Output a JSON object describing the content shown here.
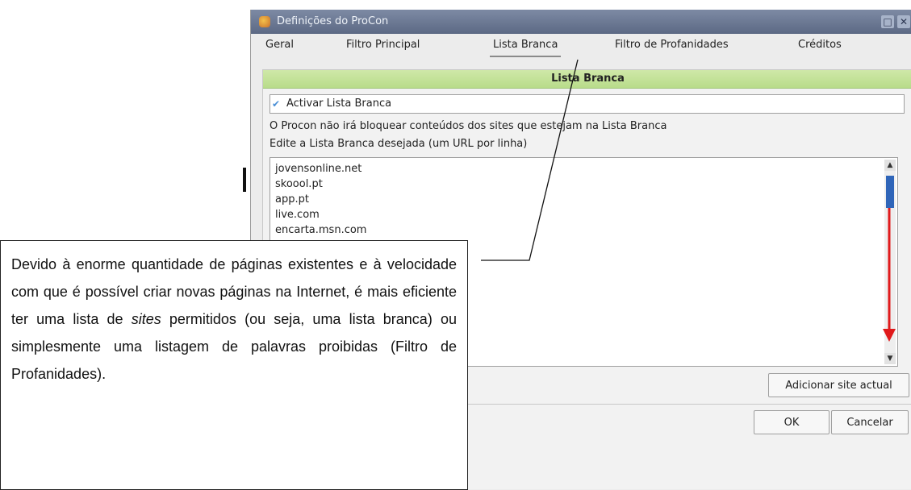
{
  "window": {
    "title": "Definições do ProCon",
    "maximize_glyph": "□",
    "close_glyph": "✕"
  },
  "tabs": [
    {
      "label": "Geral",
      "active": false
    },
    {
      "label": "Filtro Principal",
      "active": false
    },
    {
      "label": "Lista Branca",
      "active": true
    },
    {
      "label": "Filtro de Profanidades",
      "active": false
    },
    {
      "label": "Créditos",
      "active": false
    }
  ],
  "whitelist": {
    "header": "Lista Branca",
    "enable_label": "Activar Lista Branca",
    "enabled": true,
    "info_line": "O Procon não irá bloquear conteúdos dos sites que estejam na Lista Branca",
    "edit_hint": "Edite a Lista Branca desejada (um URL por linha)",
    "urls": [
      "jovensonline.net",
      "skoool.pt",
      "app.pt",
      "live.com",
      "encarta.msn.com"
    ],
    "add_button": "Adicionar site actual"
  },
  "footer": {
    "ok_label": "OK",
    "cancel_label": "Cancelar"
  },
  "annotation": {
    "text_before": "Devido à enorme quantidade de páginas existentes e à velocidade com que é possível criar novas páginas na Internet, é mais eficiente ter uma lista de ",
    "text_italic": "sites",
    "text_after": " permitidos (ou seja, uma lista branca) ou simplesmente uma listagem de palavras proibidas (Filtro de Profanidades)."
  },
  "colors": {
    "section_header": "#c3e296",
    "scroll_thumb": "#2f65b9",
    "arrow": "#e0191b",
    "titlebar": "#6b7894"
  },
  "icons": {
    "app": "procon-app-icon",
    "check": "checkmark-icon",
    "scroll_up": "scroll-up-arrow-icon",
    "scroll_down": "scroll-down-arrow-icon"
  }
}
